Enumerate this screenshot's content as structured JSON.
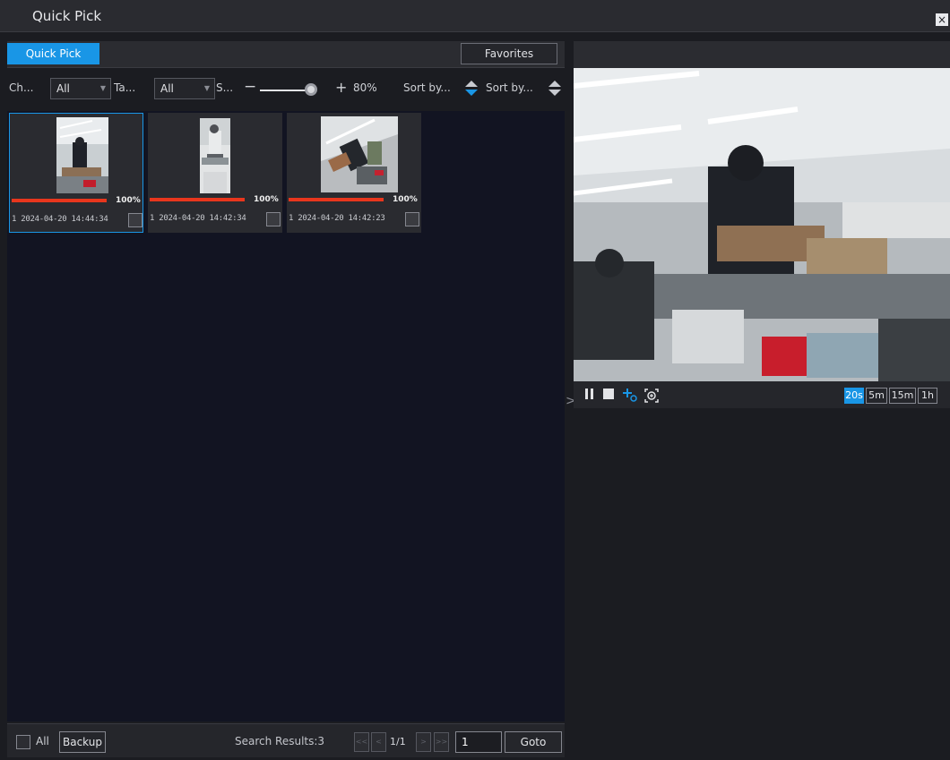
{
  "window": {
    "title": "Quick Pick",
    "close_label": "×"
  },
  "tabs": {
    "active_label": "Quick Pick",
    "favorites_label": "Favorites"
  },
  "filters": {
    "channel_label": "Ch...",
    "channel_value": "All",
    "tag_label": "Ta...",
    "tag_value": "All",
    "similarity_label": "S...",
    "minus": "−",
    "plus": "+",
    "similarity_value": "80%",
    "similarity_level": 0.8,
    "sort1_label": "Sort by...",
    "sort2_label": "Sort by..."
  },
  "results": [
    {
      "time": "1 2024-04-20 14:44:34",
      "percent": "100%",
      "progress": 1.0,
      "selected": true
    },
    {
      "time": "1 2024-04-20 14:42:34",
      "percent": "100%",
      "progress": 1.0,
      "selected": false
    },
    {
      "time": "1 2024-04-20 14:42:23",
      "percent": "100%",
      "progress": 1.0,
      "selected": false
    }
  ],
  "bottom": {
    "all_label": "All",
    "backup_label": "Backup",
    "search_results": "Search Results:3",
    "first": "<<",
    "prev": "<",
    "page": "1/1",
    "next": ">",
    "last": ">>",
    "page_input": "1",
    "goto_label": "Goto"
  },
  "player": {
    "icons": [
      "pause-icon",
      "stop-icon",
      "tag-icon",
      "zoom-icon"
    ],
    "durations": [
      "20s",
      "5m",
      "15m",
      "1h"
    ],
    "active_duration": "20s"
  },
  "colors": {
    "accent": "#1996e6",
    "progress": "#e8361d",
    "panel": "#121422"
  }
}
